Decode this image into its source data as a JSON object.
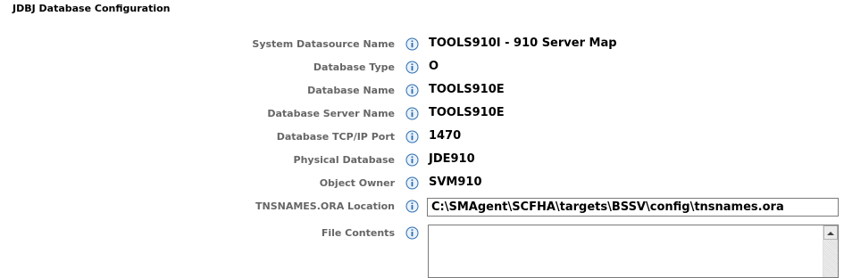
{
  "section": {
    "title": "JDBJ Database Configuration"
  },
  "fields": [
    {
      "label": "System Datasource Name",
      "value": "TOOLS910I - 910 Server Map"
    },
    {
      "label": "Database Type",
      "value": "O"
    },
    {
      "label": "Database Name",
      "value": "TOOLS910E"
    },
    {
      "label": "Database Server Name",
      "value": "TOOLS910E"
    },
    {
      "label": "Database TCP/IP Port",
      "value": "1470"
    },
    {
      "label": "Physical Database",
      "value": "JDE910"
    },
    {
      "label": "Object Owner",
      "value": "SVM910"
    }
  ],
  "tnsnames": {
    "label": "TNSNAMES.ORA Location",
    "value": "C:\\SMAgent\\SCFHA\\targets\\BSSV\\config\\tnsnames.ora"
  },
  "file_contents": {
    "label": "File Contents",
    "value": ""
  },
  "icons": {
    "info": "info-icon"
  },
  "colors": {
    "label": "#666666",
    "value": "#000000",
    "info_icon": "#2b6cb0"
  }
}
